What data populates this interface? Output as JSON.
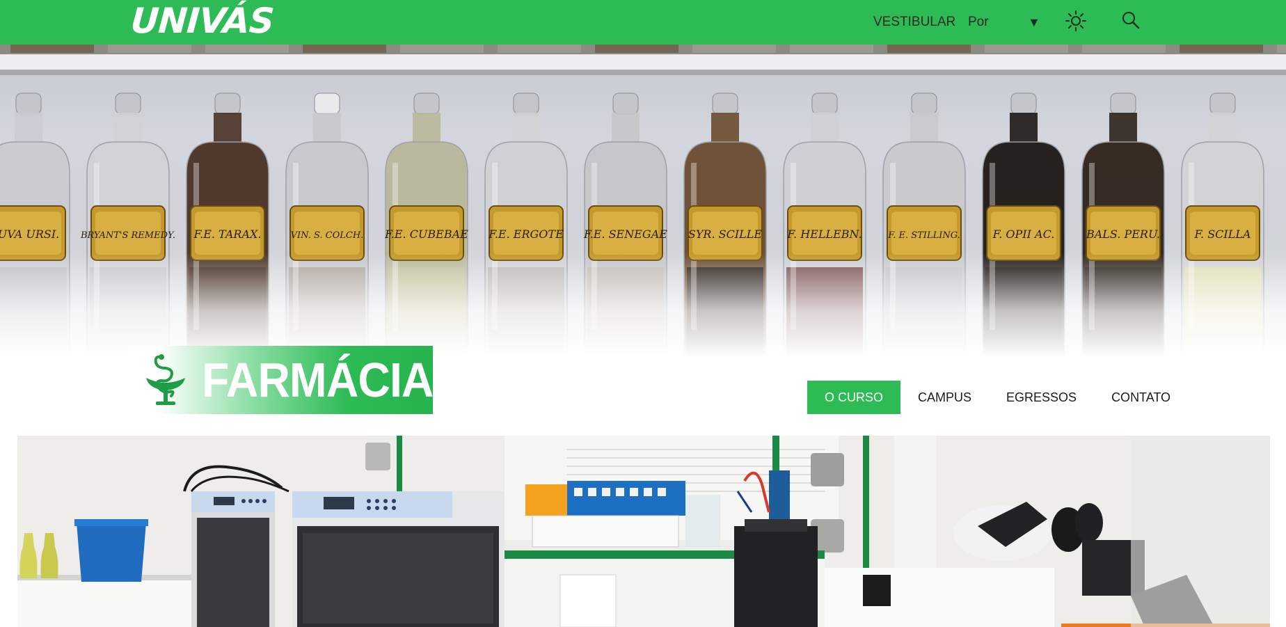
{
  "brand": {
    "logo_text": "UNIVÁS",
    "primary_color": "#2dbb55"
  },
  "topnav": {
    "vestibular_label": "VESTIBULAR",
    "language_value": "Por",
    "language_arrow": "▼",
    "theme_icon": "sun-icon",
    "search_icon": "search-icon"
  },
  "hero": {
    "bottle_labels": [
      "UVA URSI.",
      "BRYANT'S REMEDY.",
      "F.E. TARAX.",
      "VIN. S. COLCH.",
      "F.E. CUBEBAE",
      "F.E. ERGOTE",
      "F.E. SENEGAE",
      "SYR. SCILLE",
      "F. HELLEBN.",
      "F. E. STILLING.",
      "F. OPII AC.",
      "BALS. PERU.",
      "F. SCILLA"
    ]
  },
  "course": {
    "title": "FARMÁCIA",
    "icon": "caduceus-icon"
  },
  "subnav": {
    "items": [
      {
        "label": "O CURSO",
        "active": true
      },
      {
        "label": "CAMPUS",
        "active": false
      },
      {
        "label": "EGRESSOS",
        "active": false
      },
      {
        "label": "CONTATO",
        "active": false
      }
    ]
  }
}
